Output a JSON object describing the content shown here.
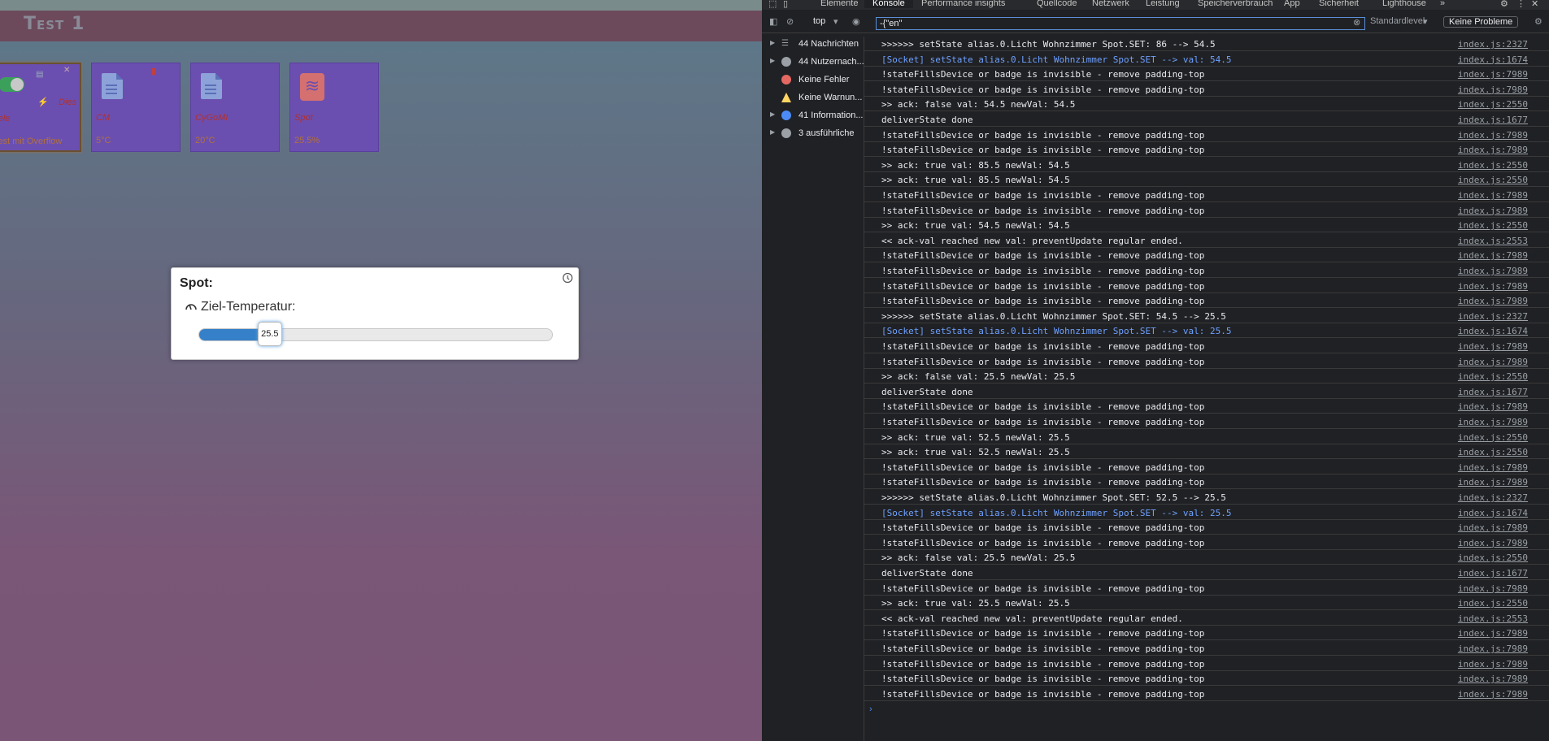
{
  "app": {
    "title": "Test 1"
  },
  "tiles": [
    {
      "name": "Tele",
      "value": "Test mit Overflow",
      "extra": "Dies"
    },
    {
      "name": "CM",
      "value": "5°C"
    },
    {
      "name": "CyGoMI",
      "value": "20°C"
    },
    {
      "name": "Spot",
      "value": "25.5%"
    }
  ],
  "dialog": {
    "title": "Spot:",
    "label": "Ziel-Temperatur:",
    "value": "25.5",
    "fraction": 0.2
  },
  "devtools": {
    "tabs": [
      "Elemente",
      "Konsole",
      "Performance insights",
      "Quellcode",
      "Netzwerk",
      "Leistung",
      "Speicherverbrauch",
      "App",
      "Sicherheit",
      "Lighthouse"
    ],
    "context": "top",
    "filter": "-{\"en\"",
    "level": "Standardlevel",
    "issues": "Keine Probleme",
    "sidebar": [
      "44 Nachrichten",
      "44 Nutzernach...",
      "Keine Fehler",
      "Keine Warnun...",
      "41 Information...",
      "3 ausführliche"
    ],
    "logs": [
      {
        "m": ">>>>>> setState alias.0.Licht Wohnzimmer Spot.SET: 86 --> 54.5",
        "s": "index.js:2327"
      },
      {
        "m": "[Socket] setState alias.0.Licht Wohnzimmer Spot.SET --> val: 54.5",
        "s": "index.js:1674",
        "blue": true
      },
      {
        "m": "!stateFillsDevice or badge is invisible - remove padding-top",
        "s": "index.js:7989"
      },
      {
        "m": "!stateFillsDevice or badge is invisible - remove padding-top",
        "s": "index.js:7989"
      },
      {
        "m": ">> ack: false val: 54.5 newVal: 54.5",
        "s": "index.js:2550"
      },
      {
        "m": "deliverState done",
        "s": "index.js:1677"
      },
      {
        "m": "!stateFillsDevice or badge is invisible - remove padding-top",
        "s": "index.js:7989"
      },
      {
        "m": "!stateFillsDevice or badge is invisible - remove padding-top",
        "s": "index.js:7989"
      },
      {
        "m": ">> ack: true val: 85.5 newVal: 54.5",
        "s": "index.js:2550"
      },
      {
        "m": ">> ack: true val: 85.5 newVal: 54.5",
        "s": "index.js:2550"
      },
      {
        "m": "!stateFillsDevice or badge is invisible - remove padding-top",
        "s": "index.js:7989"
      },
      {
        "m": "!stateFillsDevice or badge is invisible - remove padding-top",
        "s": "index.js:7989"
      },
      {
        "m": ">> ack: true val: 54.5 newVal: 54.5",
        "s": "index.js:2550"
      },
      {
        "m": "<< ack-val reached new val: preventUpdate regular ended.",
        "s": "index.js:2553"
      },
      {
        "m": "!stateFillsDevice or badge is invisible - remove padding-top",
        "s": "index.js:7989"
      },
      {
        "m": "!stateFillsDevice or badge is invisible - remove padding-top",
        "s": "index.js:7989"
      },
      {
        "m": "!stateFillsDevice or badge is invisible - remove padding-top",
        "s": "index.js:7989"
      },
      {
        "m": "!stateFillsDevice or badge is invisible - remove padding-top",
        "s": "index.js:7989"
      },
      {
        "m": ">>>>>> setState alias.0.Licht Wohnzimmer Spot.SET: 54.5 --> 25.5",
        "s": "index.js:2327"
      },
      {
        "m": "[Socket] setState alias.0.Licht Wohnzimmer Spot.SET --> val: 25.5",
        "s": "index.js:1674",
        "blue": true
      },
      {
        "m": "!stateFillsDevice or badge is invisible - remove padding-top",
        "s": "index.js:7989"
      },
      {
        "m": "!stateFillsDevice or badge is invisible - remove padding-top",
        "s": "index.js:7989"
      },
      {
        "m": ">> ack: false val: 25.5 newVal: 25.5",
        "s": "index.js:2550"
      },
      {
        "m": "deliverState done",
        "s": "index.js:1677"
      },
      {
        "m": "!stateFillsDevice or badge is invisible - remove padding-top",
        "s": "index.js:7989"
      },
      {
        "m": "!stateFillsDevice or badge is invisible - remove padding-top",
        "s": "index.js:7989"
      },
      {
        "m": ">> ack: true val: 52.5 newVal: 25.5",
        "s": "index.js:2550"
      },
      {
        "m": ">> ack: true val: 52.5 newVal: 25.5",
        "s": "index.js:2550"
      },
      {
        "m": "!stateFillsDevice or badge is invisible - remove padding-top",
        "s": "index.js:7989"
      },
      {
        "m": "!stateFillsDevice or badge is invisible - remove padding-top",
        "s": "index.js:7989"
      },
      {
        "m": ">>>>>> setState alias.0.Licht Wohnzimmer Spot.SET: 52.5 --> 25.5",
        "s": "index.js:2327"
      },
      {
        "m": "[Socket] setState alias.0.Licht Wohnzimmer Spot.SET --> val: 25.5",
        "s": "index.js:1674",
        "blue": true
      },
      {
        "m": "!stateFillsDevice or badge is invisible - remove padding-top",
        "s": "index.js:7989"
      },
      {
        "m": "!stateFillsDevice or badge is invisible - remove padding-top",
        "s": "index.js:7989"
      },
      {
        "m": ">> ack: false val: 25.5 newVal: 25.5",
        "s": "index.js:2550"
      },
      {
        "m": "deliverState done",
        "s": "index.js:1677"
      },
      {
        "m": "!stateFillsDevice or badge is invisible - remove padding-top",
        "s": "index.js:7989"
      },
      {
        "m": ">> ack: true val: 25.5 newVal: 25.5",
        "s": "index.js:2550"
      },
      {
        "m": "<< ack-val reached new val: preventUpdate regular ended.",
        "s": "index.js:2553"
      },
      {
        "m": "!stateFillsDevice or badge is invisible - remove padding-top",
        "s": "index.js:7989"
      },
      {
        "m": "!stateFillsDevice or badge is invisible - remove padding-top",
        "s": "index.js:7989"
      },
      {
        "m": "!stateFillsDevice or badge is invisible - remove padding-top",
        "s": "index.js:7989"
      },
      {
        "m": "!stateFillsDevice or badge is invisible - remove padding-top",
        "s": "index.js:7989"
      },
      {
        "m": "!stateFillsDevice or badge is invisible - remove padding-top",
        "s": "index.js:7989"
      }
    ]
  }
}
